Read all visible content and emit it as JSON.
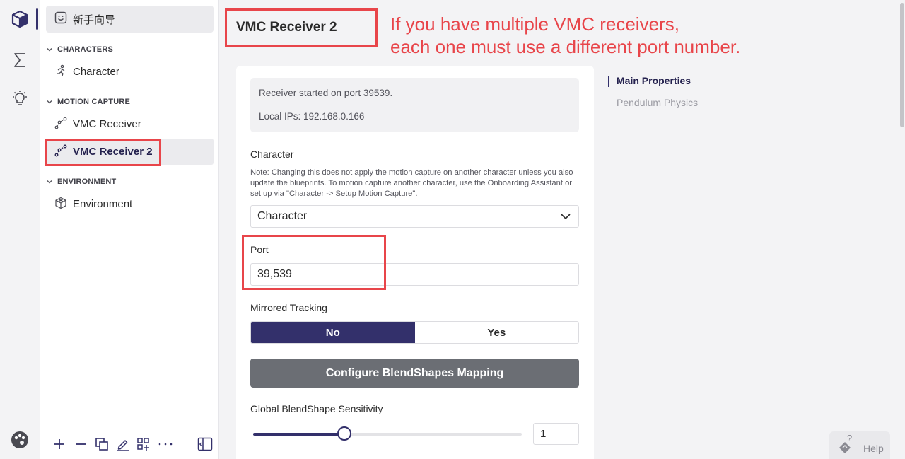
{
  "onboarding": {
    "label": "新手向导"
  },
  "sidebar": {
    "sections": [
      {
        "title": "CHARACTERS",
        "items": [
          {
            "label": "Character",
            "icon": "running-figure-icon"
          }
        ]
      },
      {
        "title": "MOTION CAPTURE",
        "items": [
          {
            "label": "VMC Receiver",
            "icon": "motion-nodes-icon"
          },
          {
            "label": "VMC Receiver 2",
            "icon": "motion-nodes-icon",
            "selected": true
          }
        ]
      },
      {
        "title": "ENVIRONMENT",
        "items": [
          {
            "label": "Environment",
            "icon": "cube-icon"
          }
        ]
      }
    ],
    "toolbar": [
      "add-icon",
      "remove-icon",
      "duplicate-icon",
      "rename-icon",
      "add-grid-icon",
      "more-icon",
      "toggle-panel-icon"
    ]
  },
  "main": {
    "title": "VMC Receiver 2",
    "annotation_line1": "If you have multiple VMC receivers,",
    "annotation_line2": "each one must use a different port number.",
    "status": {
      "line1": "Receiver started on port 39539.",
      "line2": "Local IPs: 192.168.0.166"
    },
    "character": {
      "label": "Character",
      "note": "Note: Changing this does not apply the motion capture on another character unless you also update the blueprints. To motion capture another character, use the Onboarding Assistant or set up via \"Character -> Setup Motion Capture\".",
      "value": "Character"
    },
    "port": {
      "label": "Port",
      "value": "39,539"
    },
    "mirrored": {
      "label": "Mirrored Tracking",
      "options": [
        "No",
        "Yes"
      ],
      "selected": "No"
    },
    "configure_button": "Configure BlendShapes Mapping",
    "sensitivity": {
      "label": "Global BlendShape Sensitivity",
      "value": "1",
      "slider_fraction": 0.34
    }
  },
  "toc": {
    "items": [
      "Main Properties",
      "Pendulum Physics"
    ],
    "active": "Main Properties"
  },
  "help": {
    "label": "Help"
  },
  "colors": {
    "accent": "#33306b",
    "annotation": "#e8454a",
    "button_gray": "#6b6e74"
  }
}
